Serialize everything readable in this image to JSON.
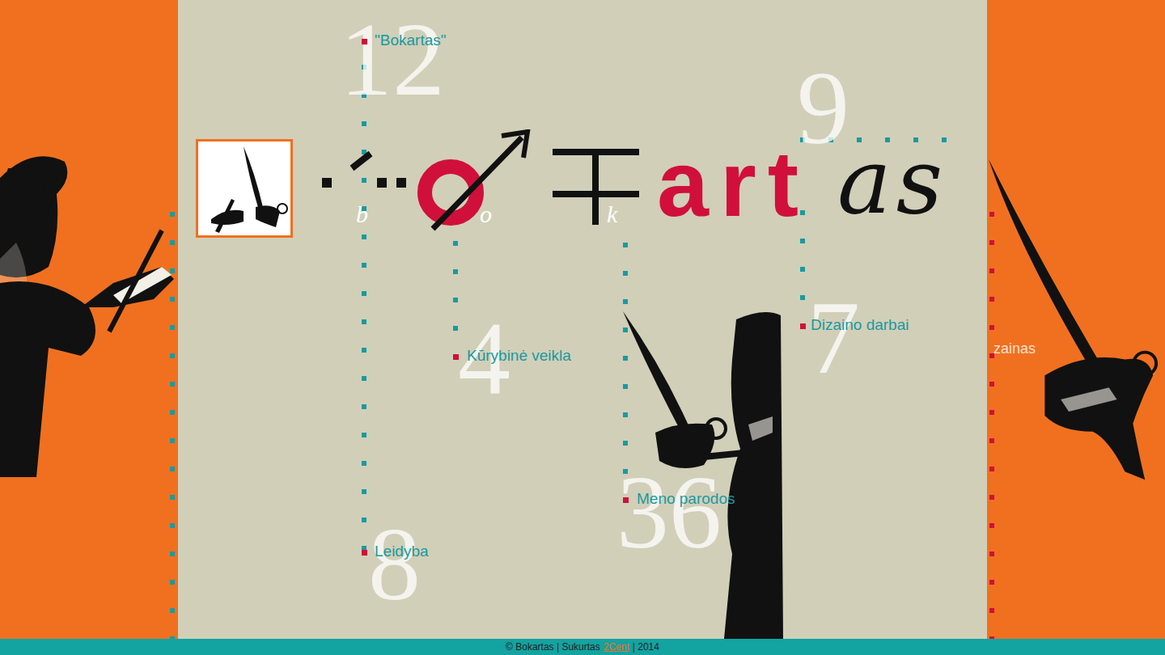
{
  "logo": {
    "marks": [
      "b",
      "o",
      "k"
    ],
    "accent": "art",
    "tail": "as"
  },
  "menu": [
    {
      "label": "\"Bokartas\"",
      "number": "12"
    },
    {
      "label": "Kūrybinė veikla",
      "number": "4"
    },
    {
      "label": "Meno parodos",
      "number": "36"
    },
    {
      "label": "Dizaino darbai",
      "number": "7",
      "sub": "zainas"
    },
    {
      "label": "Leidyba",
      "number": "8"
    }
  ],
  "extra_number": "9",
  "footer": {
    "prefix": "© Bokartas | Sukurtas",
    "link": "2Cent",
    "suffix": "| 2014"
  }
}
